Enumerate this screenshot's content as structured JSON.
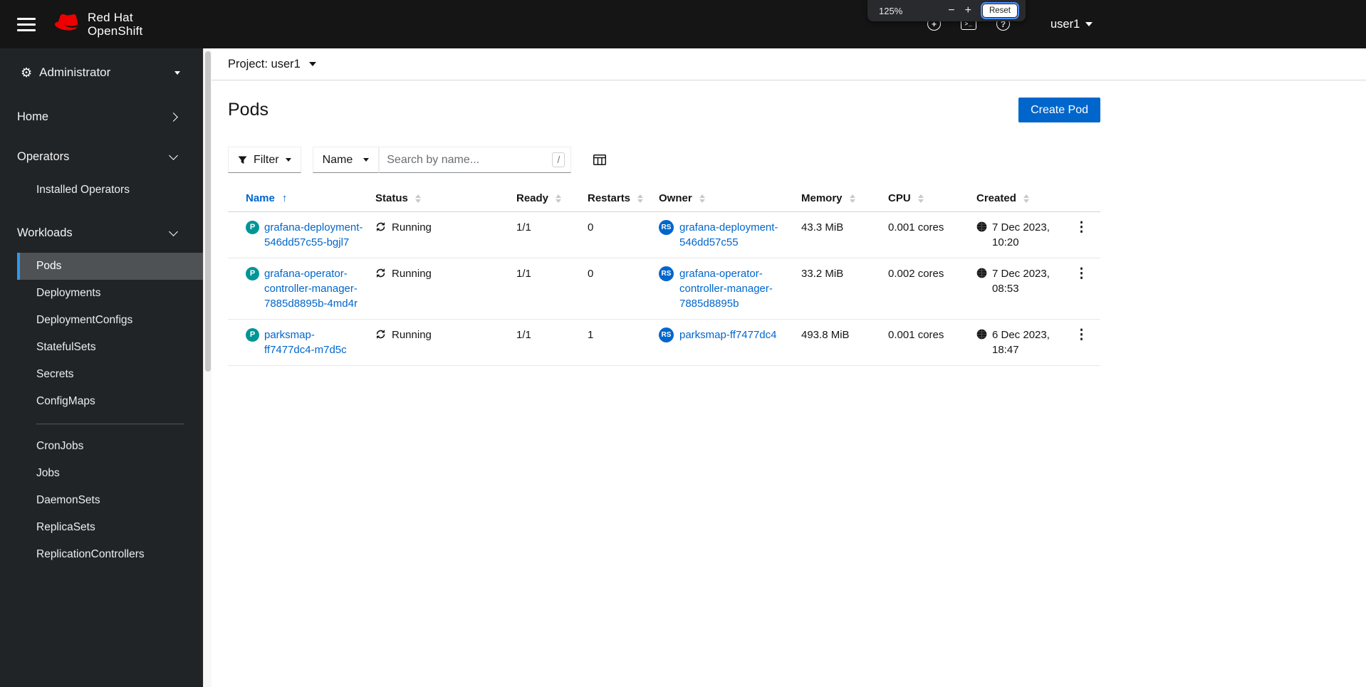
{
  "masthead": {
    "brand_line1": "Red Hat",
    "brand_line2": "OpenShift",
    "user_label": "user1"
  },
  "zoom_popup": {
    "level": "125%",
    "zoom_out": "−",
    "zoom_in": "+",
    "reset_label": "Reset"
  },
  "icons": {
    "gear": "⚙",
    "plus": "+",
    "terminal": ">_",
    "help": "?",
    "kebab": "⋮",
    "sort_ascending": "↑"
  },
  "sidebar": {
    "perspective": "Administrator",
    "home": "Home",
    "operators": "Operators",
    "installed_operators": "Installed Operators",
    "workloads": "Workloads",
    "workloads_items": [
      "Pods",
      "Deployments",
      "DeploymentConfigs",
      "StatefulSets",
      "Secrets",
      "ConfigMaps",
      "CronJobs",
      "Jobs",
      "DaemonSets",
      "ReplicaSets",
      "ReplicationControllers"
    ],
    "selected_item": "Pods"
  },
  "project_bar": {
    "label": "Project: user1"
  },
  "page": {
    "title": "Pods",
    "create_button": "Create Pod"
  },
  "toolbar": {
    "filter_label": "Filter",
    "attribute_label": "Name",
    "search_placeholder": "Search by name...",
    "shortcut_hint": "/"
  },
  "table": {
    "columns": [
      "Name",
      "Status",
      "Ready",
      "Restarts",
      "Owner",
      "Memory",
      "CPU",
      "Created"
    ],
    "sorted_column": "Name",
    "sort_direction": "ascending",
    "rows": [
      {
        "badge": "P",
        "name": "grafana-deployment-546dd57c55-bgjl7",
        "status": "Running",
        "ready": "1/1",
        "restarts": "0",
        "owner_badge": "RS",
        "owner": "grafana-deployment-546dd57c55",
        "memory": "43.3 MiB",
        "cpu": "0.001 cores",
        "created_date": "7 Dec 2023,",
        "created_time": "10:20"
      },
      {
        "badge": "P",
        "name": "grafana-operator-controller-manager-7885d8895b-4md4r",
        "status": "Running",
        "ready": "1/1",
        "restarts": "0",
        "owner_badge": "RS",
        "owner": "grafana-operator-controller-manager-7885d8895b",
        "memory": "33.2 MiB",
        "cpu": "0.002 cores",
        "created_date": "7 Dec 2023,",
        "created_time": "08:53"
      },
      {
        "badge": "P",
        "name": "parksmap-ff7477dc4-m7d5c",
        "status": "Running",
        "ready": "1/1",
        "restarts": "1",
        "owner_badge": "RS",
        "owner": "parksmap-ff7477dc4",
        "memory": "493.8 MiB",
        "cpu": "0.001 cores",
        "created_date": "6 Dec 2023,",
        "created_time": "18:47"
      }
    ]
  },
  "colors": {
    "primary": "#0066cc",
    "pod_badge": "#009596",
    "replicaset_badge": "#0066cc",
    "masthead_bg": "#151515",
    "sidebar_bg": "#212427",
    "nav_selected_bg": "#4f5255",
    "nav_selected_border": "#2b9af3",
    "brand_red": "#ee0000"
  }
}
